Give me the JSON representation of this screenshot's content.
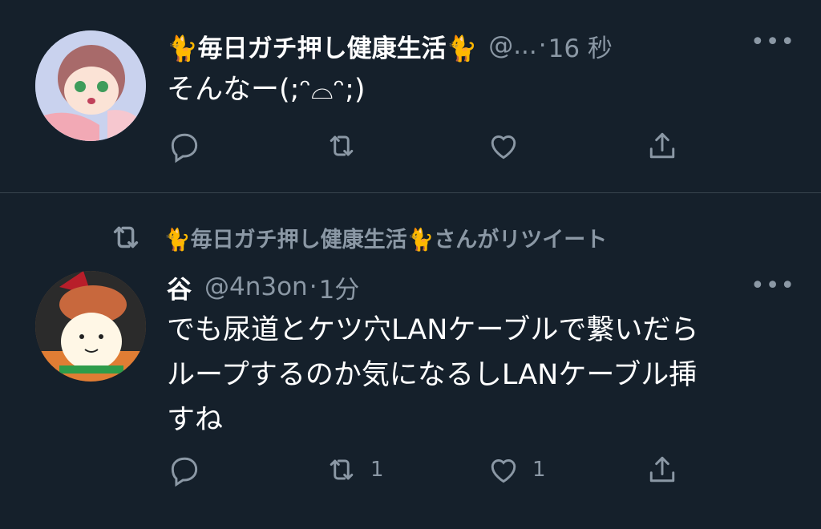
{
  "tweet1": {
    "display_name": "🐈毎日ガチ押し健康生活🐈",
    "handle": "@...",
    "separator": "·",
    "time": "16 秒",
    "text": "そんなー(;ᵔ⌓ᵔ;)"
  },
  "retweet_banner": {
    "text": "🐈毎日ガチ押し健康生活🐈さんがリツイート"
  },
  "tweet2": {
    "display_name": "谷",
    "handle": "@4n3on",
    "separator": "·",
    "time": "1分",
    "text_line1": "でも尿道とケツ穴LANケーブルで繋いだら",
    "text_line2": "ループするのか気になるしLANケーブル挿",
    "text_line3": "すね",
    "retweet_count": "1",
    "like_count": "1"
  },
  "icons": {
    "more": "more-icon",
    "reply": "reply-icon",
    "retweet": "retweet-icon",
    "like": "like-icon",
    "share": "share-icon"
  },
  "colors": {
    "background": "#15202b",
    "muted": "#8b98a5",
    "divider": "#38444d",
    "text": "#ffffff"
  }
}
